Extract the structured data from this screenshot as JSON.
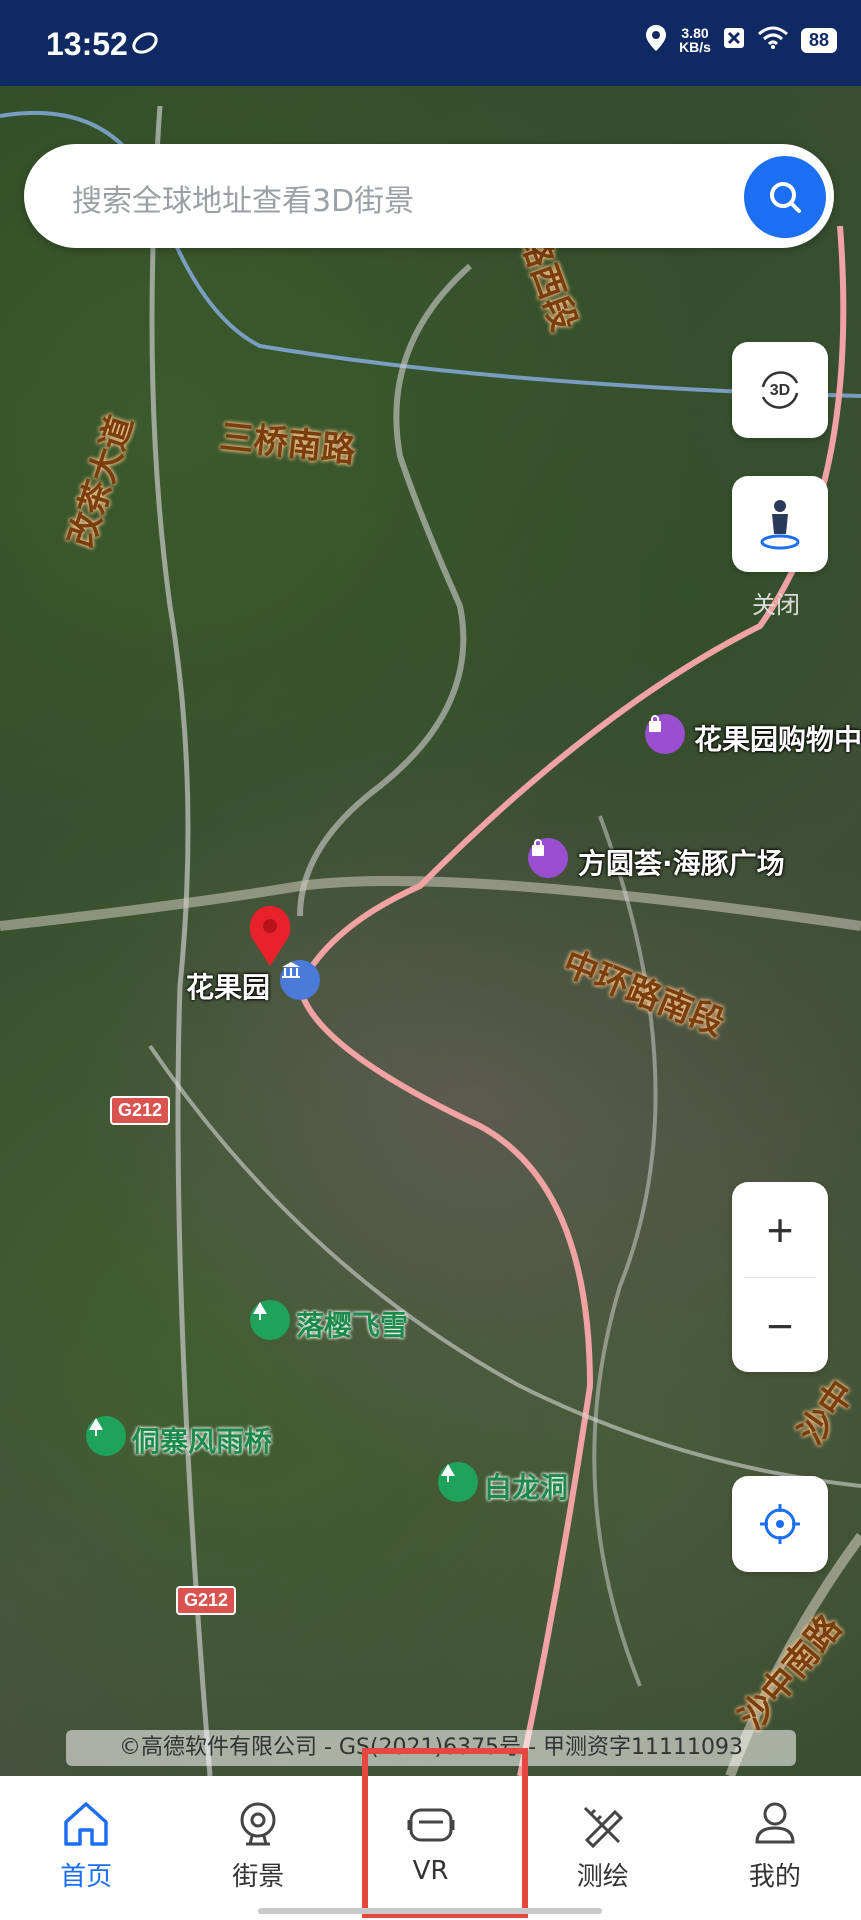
{
  "status_bar": {
    "time": "13:52",
    "speed_value": "3.80",
    "speed_unit": "KB/s",
    "battery": "88"
  },
  "search": {
    "placeholder": "搜索全球地址查看3D街景",
    "icon": "search-icon"
  },
  "map_controls": {
    "btn_3d_icon": "3d-rotate-icon",
    "streetview_icon": "person-pin-icon",
    "streetview_label": "关闭",
    "zoom_in": "+",
    "zoom_out": "−",
    "locate_icon": "crosshair-icon"
  },
  "map_labels": {
    "roads": [
      "路西段",
      "三桥南路",
      "改茶大道",
      "中环路南段",
      "沙中",
      "沙中南路"
    ],
    "pois": [
      {
        "name": "花果园购物中",
        "icon": "shopping-bag-icon",
        "color": "#9a4fd0"
      },
      {
        "name": "方圆荟·海豚广场",
        "icon": "shopping-bag-icon",
        "color": "#9a4fd0"
      },
      {
        "name": "花果园",
        "icon": "government-icon",
        "color": "#4a7bd8"
      },
      {
        "name": "落樱飞雪",
        "icon": "tree-icon",
        "color": "#1fa35a"
      },
      {
        "name": "侗寨风雨桥",
        "icon": "tree-icon",
        "color": "#1fa35a"
      },
      {
        "name": "白龙洞",
        "icon": "tree-icon",
        "color": "#1fa35a"
      }
    ],
    "shields": [
      "G212",
      "G212"
    ]
  },
  "copyright": "©高德软件有限公司 - GS(2021)6375号 - 甲测资字11111093",
  "tabs": [
    {
      "label": "首页",
      "icon": "home-icon",
      "active": true
    },
    {
      "label": "街景",
      "icon": "camera-icon",
      "active": false
    },
    {
      "label": "VR",
      "icon": "vr-headset-icon",
      "active": false
    },
    {
      "label": "测绘",
      "icon": "ruler-pencil-icon",
      "active": false
    },
    {
      "label": "我的",
      "icon": "user-icon",
      "active": false
    }
  ],
  "colors": {
    "status_bar_bg": "#0f2a63",
    "accent": "#1c6ef2",
    "highlight_box": "#e5483f"
  }
}
